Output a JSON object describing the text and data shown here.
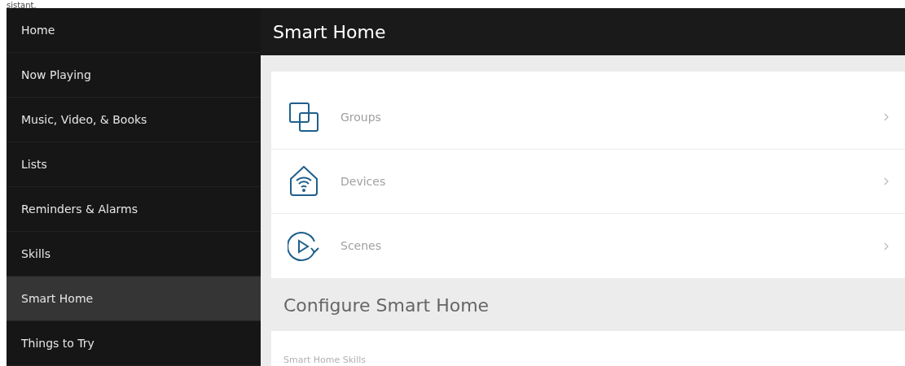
{
  "caption": "sistant.",
  "sidebar": {
    "items": [
      {
        "label": "Home",
        "selected": false
      },
      {
        "label": "Now Playing",
        "selected": false
      },
      {
        "label": "Music, Video, & Books",
        "selected": false
      },
      {
        "label": "Lists",
        "selected": false
      },
      {
        "label": "Reminders & Alarms",
        "selected": false
      },
      {
        "label": "Skills",
        "selected": false
      },
      {
        "label": "Smart Home",
        "selected": true
      },
      {
        "label": "Things to Try",
        "selected": false
      }
    ]
  },
  "header": {
    "title": "Smart Home"
  },
  "menu": [
    {
      "kind": "groups",
      "label": "Groups"
    },
    {
      "kind": "devices",
      "label": "Devices"
    },
    {
      "kind": "scenes",
      "label": "Scenes"
    }
  ],
  "configure": {
    "title": "Configure Smart Home",
    "items": [
      "Smart Home Skills"
    ]
  }
}
